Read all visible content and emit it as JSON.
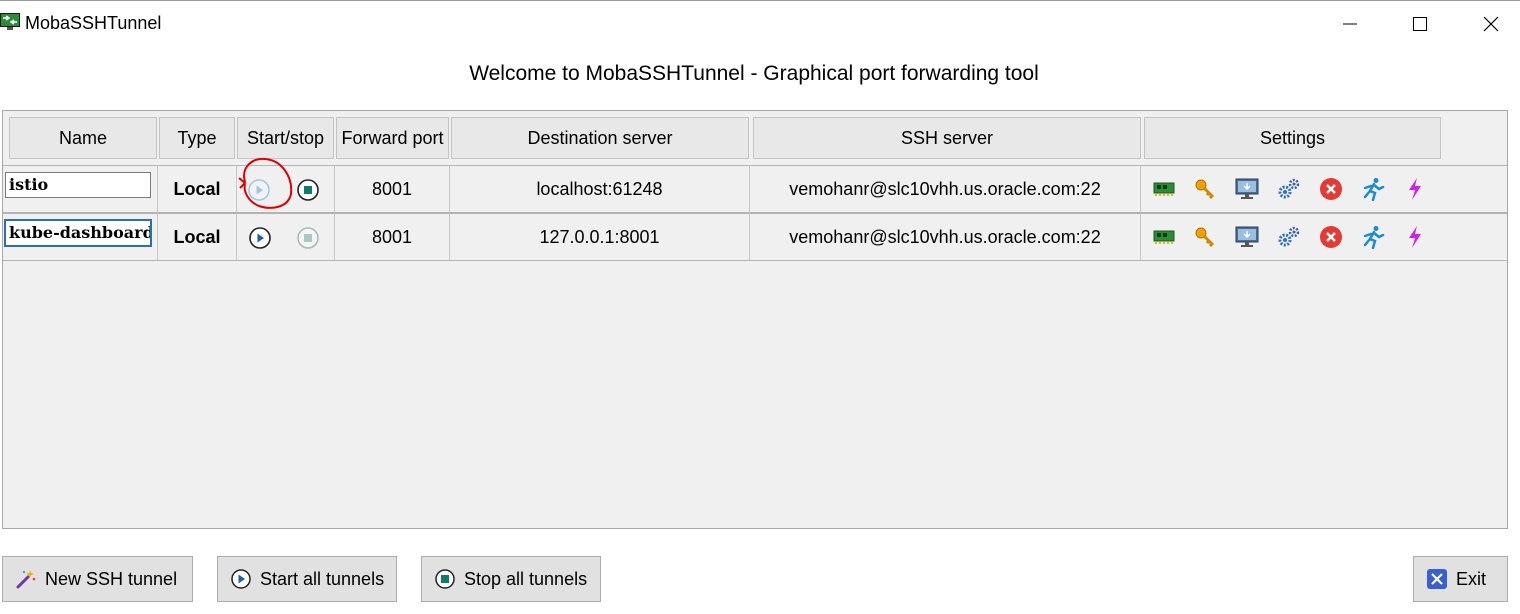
{
  "window": {
    "title": "MobaSSHTunnel"
  },
  "welcome": "Welcome to MobaSSHTunnel - Graphical port forwarding tool",
  "columns": [
    "Name",
    "Type",
    "Start/stop",
    "Forward port",
    "Destination server",
    "SSH server",
    "Settings"
  ],
  "tunnels": [
    {
      "name": "istio",
      "type": "Local",
      "running": true,
      "forward_port": "8001",
      "destination": "localhost:61248",
      "ssh_server": "vemohanr@slc10vhh.us.oracle.com:22"
    },
    {
      "name": "kube-dashboard",
      "type": "Local",
      "running": false,
      "forward_port": "8001",
      "destination": "127.0.0.1:8001",
      "ssh_server": "vemohanr@slc10vhh.us.oracle.com:22"
    }
  ],
  "settings_icons": [
    "network-card-icon",
    "key-icon",
    "monitor-icon",
    "gears-icon",
    "delete-icon",
    "run-icon",
    "lightning-icon"
  ],
  "buttons": {
    "new_tunnel": "New SSH tunnel",
    "start_all": "Start all tunnels",
    "stop_all": "Stop all tunnels",
    "exit": "Exit"
  },
  "colors": {
    "play_blue": "#1b5fa8",
    "stop_teal": "#0c7c6e",
    "delete_red": "#e53935",
    "key_orange": "#f0a000",
    "bolt_magenta": "#d020f0",
    "annotation_red": "#e00000"
  }
}
